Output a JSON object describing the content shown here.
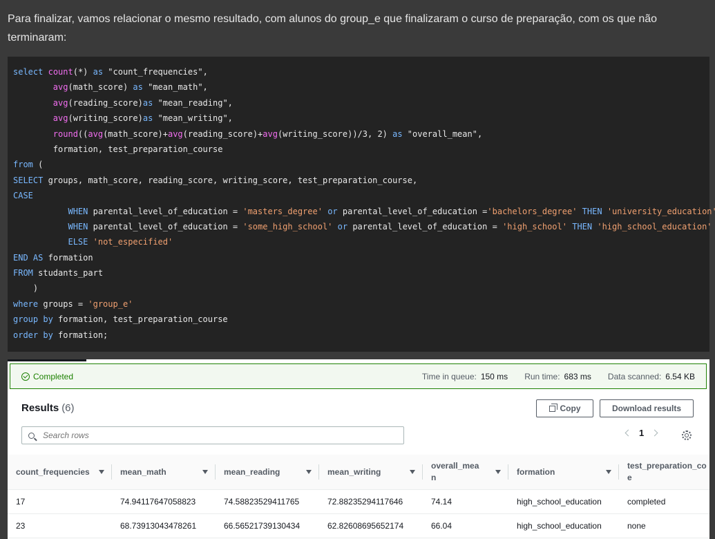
{
  "intro_text": "Para finalizar, vamos relacionar o mesmo resultado, com alunos do group_e que finalizaram o curso de preparação, com os que não terminaram:",
  "status": {
    "label": "Completed",
    "time_in_queue_label": "Time in queue:",
    "time_in_queue_value": "150 ms",
    "run_time_label": "Run time:",
    "run_time_value": "683 ms",
    "data_scanned_label": "Data scanned:",
    "data_scanned_value": "6.54 KB"
  },
  "results": {
    "title": "Results",
    "count": "(6)",
    "copy_label": "Copy",
    "download_label": "Download results",
    "search_placeholder": "Search rows",
    "page": "1"
  },
  "table": {
    "columns": [
      "count_frequencies",
      "mean_math",
      "mean_reading",
      "mean_writing",
      "overall_mea\nn",
      "formation",
      "test_preparation_co\ne"
    ],
    "rows": [
      [
        "17",
        "74.94117647058823",
        "74.58823529411765",
        "72.88235294117646",
        "74.14",
        "high_school_education",
        "completed"
      ],
      [
        "23",
        "68.73913043478261",
        "66.56521739130434",
        "62.82608695652174",
        "66.04",
        "high_school_education",
        "none"
      ]
    ]
  },
  "colors": {
    "keyword": "#79b8ff",
    "function": "#f26ef0",
    "string": "#f0a070",
    "success": "#1d8102"
  }
}
